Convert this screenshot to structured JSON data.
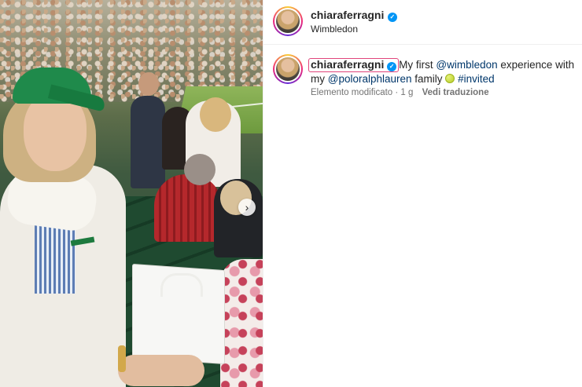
{
  "header": {
    "username": "chiaraferragni",
    "location": "Wimbledon"
  },
  "caption": {
    "username": "chiaraferragni",
    "text_1": "My first ",
    "mention_1": "@wimbledon",
    "text_2": " experience with my ",
    "mention_2": "@poloralphlauren",
    "text_3": " family ",
    "hashtag": "#invited"
  },
  "meta": {
    "edited_time": "Elemento modificato · 1 g",
    "translate_label": "Vedi traduzione"
  },
  "carousel": {
    "next_icon": "›"
  },
  "colors": {
    "verified": "#0095f6",
    "mention": "#00376b",
    "highlight_box": "#e0457b"
  }
}
